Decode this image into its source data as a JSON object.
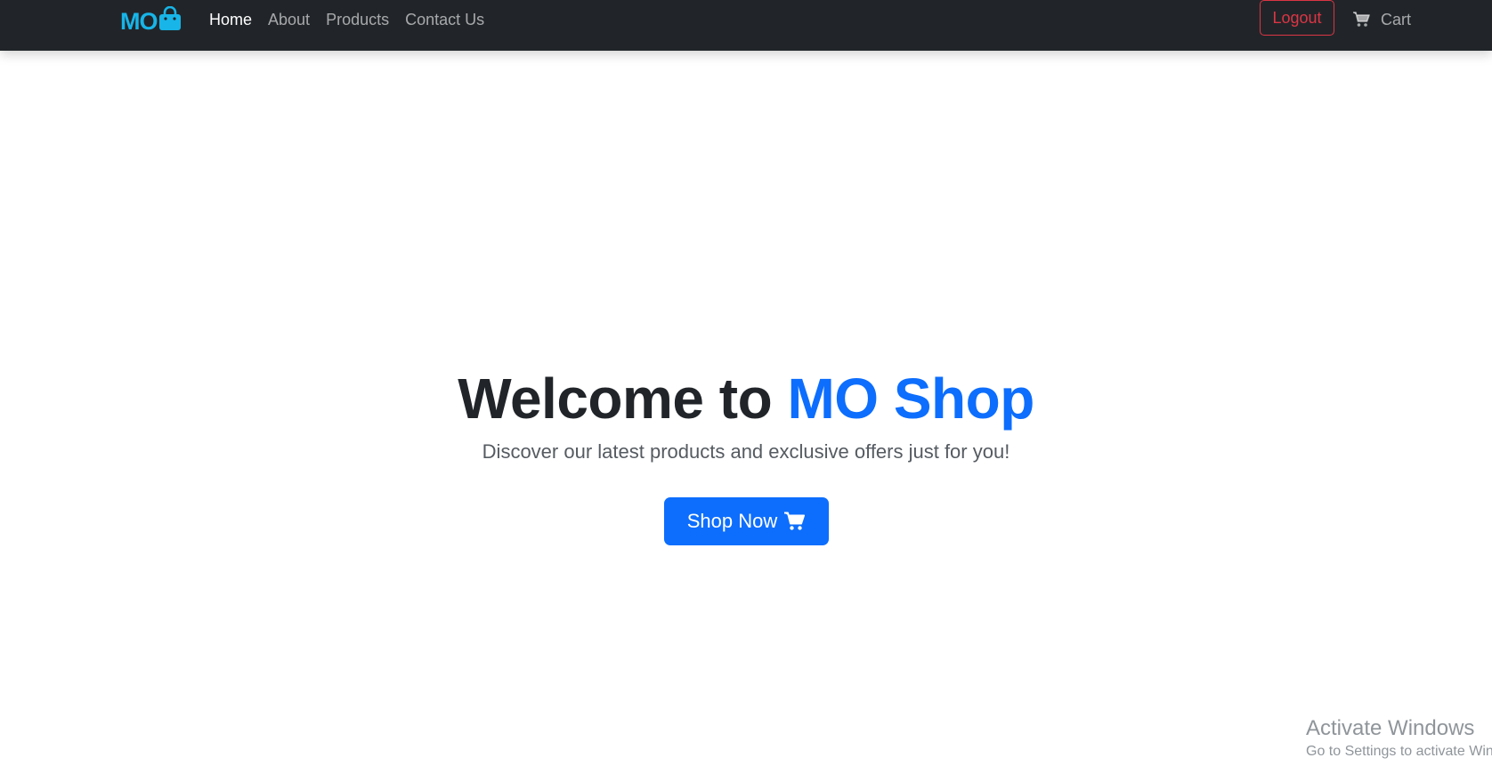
{
  "navbar": {
    "brand_text": "MO",
    "brand_icon": "shopping-bag-icon",
    "brand_color": "#17b5e8",
    "links": [
      {
        "label": "Home",
        "active": true
      },
      {
        "label": "About",
        "active": false
      },
      {
        "label": "Products",
        "active": false
      },
      {
        "label": "Contact Us",
        "active": false
      }
    ],
    "logout_label": "Logout",
    "cart_label": "Cart",
    "cart_icon": "cart-icon"
  },
  "hero": {
    "title_prefix": "Welcome to ",
    "title_accent": "MO Shop",
    "subtitle": "Discover our latest products and exclusive offers just for you!",
    "button_label": "Shop Now",
    "button_icon": "cart-icon"
  },
  "watermark": {
    "title": "Activate Windows",
    "subtitle": "Go to Settings to activate Windows."
  },
  "colors": {
    "navbar_bg": "#212529",
    "primary": "#0d6efd",
    "danger": "#dc3545"
  }
}
